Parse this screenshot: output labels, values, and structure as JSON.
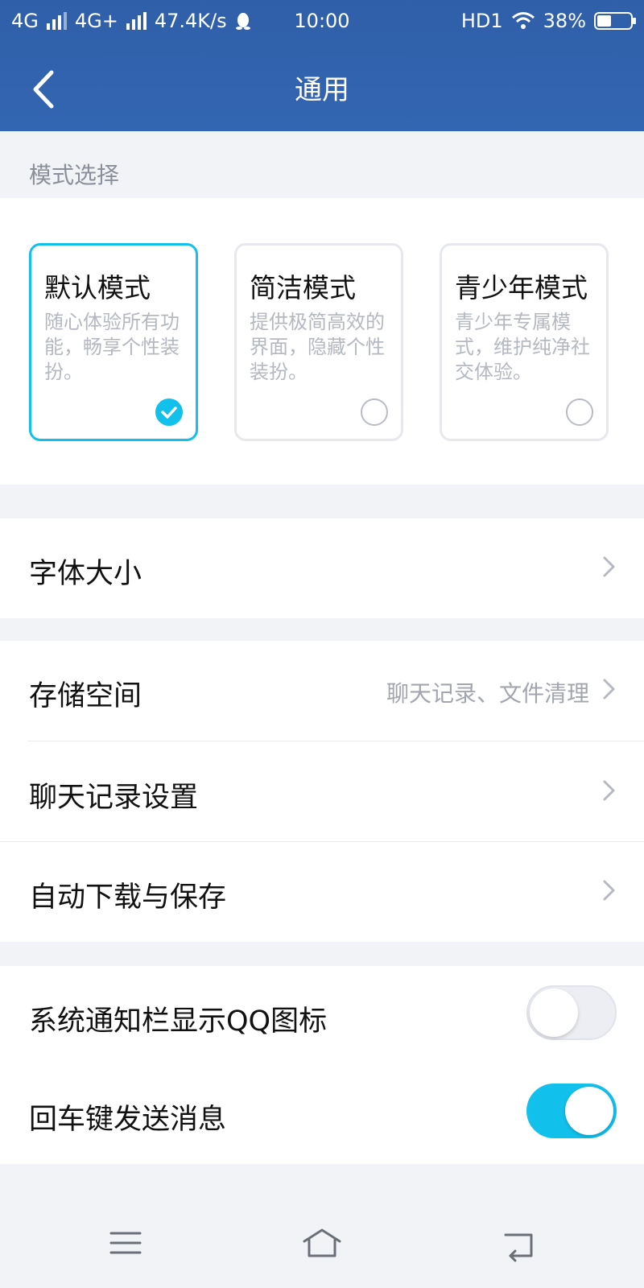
{
  "status_bar": {
    "sim1": "4G",
    "sim2": "4G+",
    "speed": "47.4K/s",
    "time": "10:00",
    "hd": "HD1",
    "battery": "38%",
    "battery_level": 0.38
  },
  "header": {
    "title": "通用"
  },
  "mode_section": {
    "label": "模式选择",
    "modes": [
      {
        "name": "默认模式",
        "desc": "随心体验所有功能，畅享个性装扮。",
        "selected": true
      },
      {
        "name": "简洁模式",
        "desc": "提供极简高效的界面，隐藏个性装扮。",
        "selected": false
      },
      {
        "name": "青少年模式",
        "desc": "青少年专属模式，维护纯净社交体验。",
        "selected": false
      }
    ]
  },
  "rows": {
    "font_size": {
      "label": "字体大小"
    },
    "storage": {
      "label": "存储空间",
      "value": "聊天记录、文件清理"
    },
    "chat_history": {
      "label": "聊天记录设置"
    },
    "auto_download": {
      "label": "自动下载与保存"
    },
    "notify_icon": {
      "label": "系统通知栏显示QQ图标",
      "on": false
    },
    "enter_send": {
      "label": "回车键发送消息",
      "on": true
    }
  },
  "colors": {
    "header_blue": "#3366b2",
    "accent": "#12c0ec"
  }
}
